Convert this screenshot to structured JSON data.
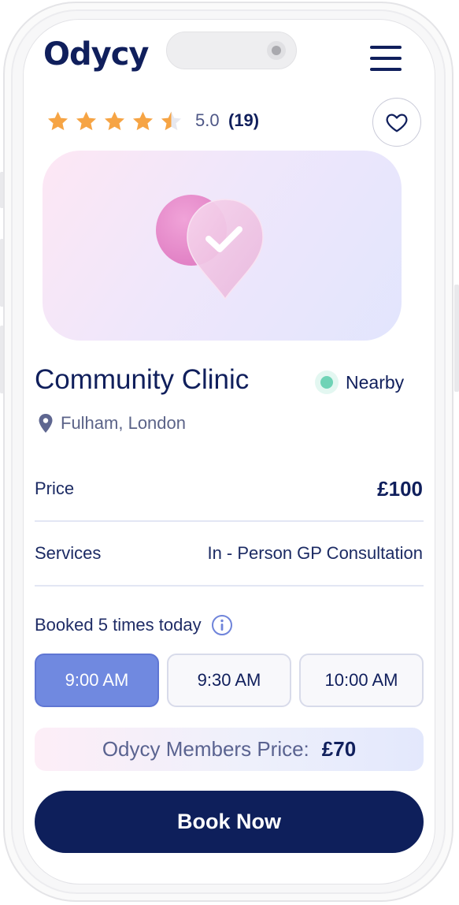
{
  "brand": {
    "logo_text": "Odycy"
  },
  "rating": {
    "stars": 4.5,
    "max_stars": 5,
    "value": "5.0",
    "count": "(19)"
  },
  "clinic": {
    "name": "Community Clinic",
    "proximity_label": "Nearby",
    "location": "Fulham, London"
  },
  "details": {
    "price_label": "Price",
    "price_value": "£100",
    "services_label": "Services",
    "services_value": "In - Person GP Consultation"
  },
  "booking": {
    "booked_text": "Booked 5 times today",
    "time_slots": [
      {
        "time": "9:00 AM",
        "selected": true
      },
      {
        "time": "9:30 AM",
        "selected": false
      },
      {
        "time": "10:00 AM",
        "selected": false
      }
    ]
  },
  "members": {
    "label": "Odycy Members Price:",
    "price": "£70"
  },
  "cta": {
    "label": "Book Now"
  },
  "icons": {
    "menu": "hamburger-menu-icon",
    "favorite": "heart-icon",
    "location": "map-pin-icon",
    "info": "info-icon",
    "hero": "check-location-pin-icon"
  },
  "colors": {
    "navy": "#0e1f5b",
    "star": "#f6a444",
    "selected_slot": "#7089e0",
    "nearby": "#6fd3b6",
    "hero_pink": "#e98ac9"
  }
}
